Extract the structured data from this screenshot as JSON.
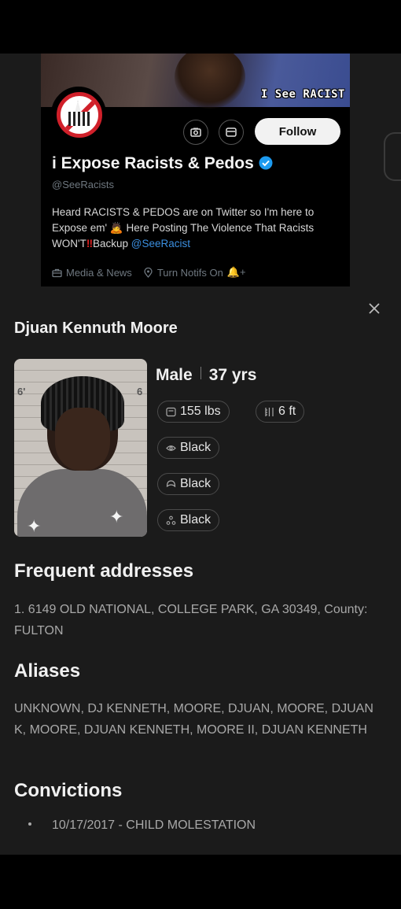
{
  "twitter_card": {
    "banner_text": "I See RACIST",
    "follow_label": "Follow",
    "display_name": "i Expose Racists & Pedos",
    "handle": "@SeeRacists",
    "bio_part1": "Heard RACISTS & PEDOS are on Twitter so I'm here to Expose em' ",
    "bio_emoji": "🙇",
    "bio_part2": " Here Posting The Violence That Racists WON'T",
    "bio_bang": "‼",
    "bio_part3": "Backup ",
    "bio_link": "@SeeRacist",
    "category": "Media & News",
    "location": "Turn Notifs On",
    "location_suffix": "🔔+"
  },
  "profile": {
    "name": "Djuan Kennuth Moore",
    "sex": "Male",
    "age": "37 yrs",
    "weight": "155 lbs",
    "height": "6 ft",
    "eye_color": "Black",
    "hair_color": "Black",
    "race": "Black",
    "mugshot_height_marks": [
      "6'",
      "6"
    ]
  },
  "sections": {
    "addresses_title": "Frequent addresses",
    "addresses_text": "1. 6149 OLD NATIONAL, COLLEGE PARK, GA 30349, County: FULTON",
    "aliases_title": "Aliases",
    "aliases_text": "UNKNOWN, DJ KENNETH, MOORE, DJUAN, MOORE, DJUAN K, MOORE, DJUAN KENNETH, MOORE II, DJUAN KENNETH",
    "convictions_title": "Convictions",
    "convictions": [
      "10/17/2017 - CHILD MOLESTATION"
    ]
  },
  "colors": {
    "background": "#1b1b1b",
    "link": "#3b8fe0",
    "verified": "#1d9bf0",
    "muted_text": "#a8a8a8"
  },
  "icons": [
    "camera-icon",
    "mail-icon",
    "verified-badge-icon",
    "briefcase-icon",
    "location-pin-icon",
    "close-icon",
    "scale-icon",
    "ruler-icon",
    "eye-icon",
    "hair-icon",
    "race-icon"
  ]
}
